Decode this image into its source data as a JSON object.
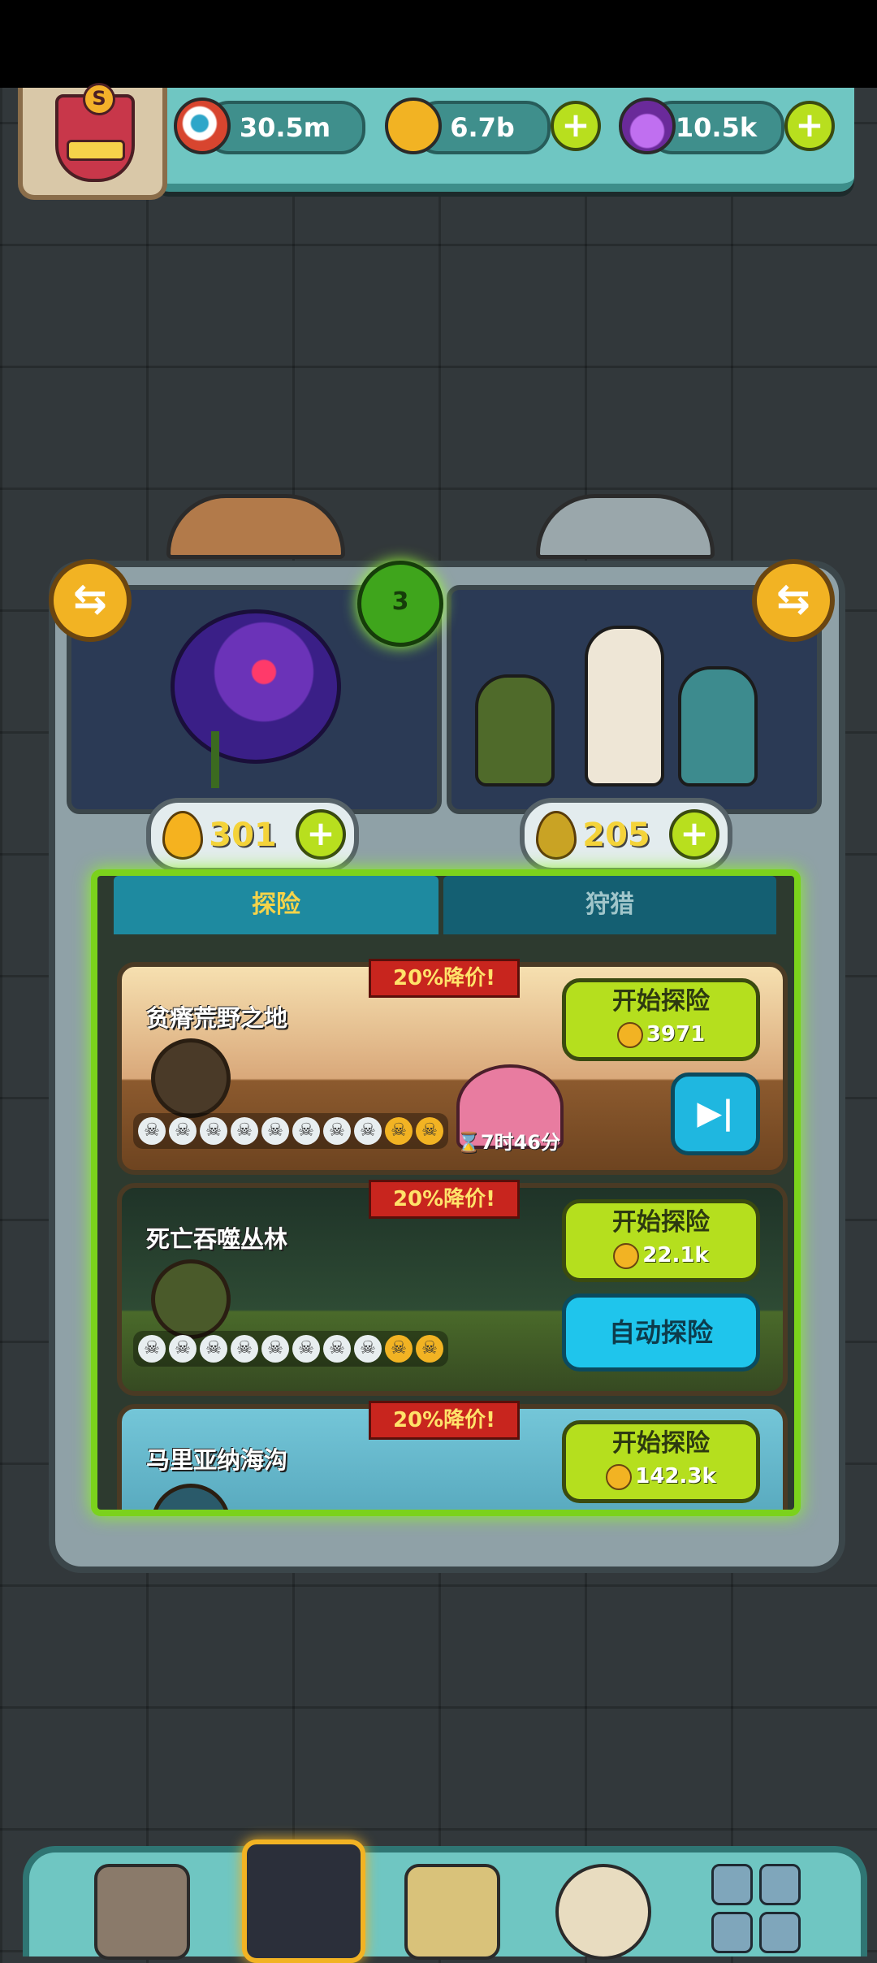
{
  "resources": [
    {
      "name": "eyeball",
      "value": "30.5m",
      "icon": "eyeball-icon",
      "color": "#d8452f",
      "has_plus": false
    },
    {
      "name": "coin",
      "value": "6.7b",
      "icon": "coin-icon",
      "color": "#f2b323",
      "has_plus": true
    },
    {
      "name": "potion",
      "value": "10.5k",
      "icon": "potion-icon",
      "color": "#a24fd6",
      "has_plus": true
    }
  ],
  "emblem_letter": "S",
  "clover_count": "3",
  "currency": [
    {
      "value": "301"
    },
    {
      "value": "205"
    }
  ],
  "tabs": [
    {
      "label": "探险",
      "active": true
    },
    {
      "label": "狩猎",
      "active": false
    }
  ],
  "expeditions": [
    {
      "discount": "20%降价!",
      "name": "贫瘠荒野之地",
      "start_label": "开始探险",
      "cost": "3971",
      "timer": "7时46分",
      "skulls": {
        "white": 8,
        "gold": 2
      }
    },
    {
      "discount": "20%降价!",
      "name": "死亡吞噬丛林",
      "start_label": "开始探险",
      "cost": "22.1k",
      "auto_label": "自动探险",
      "skulls": {
        "white": 8,
        "gold": 2
      }
    },
    {
      "discount": "20%降价!",
      "name": "马里亚纳海沟",
      "start_label": "开始探险",
      "cost": "142.3k"
    }
  ],
  "nav": [
    {
      "name": "shop",
      "icon": "shop-icon"
    },
    {
      "name": "explore",
      "icon": "monster-icon",
      "active": true
    },
    {
      "name": "book",
      "icon": "book-icon"
    },
    {
      "name": "bag",
      "icon": "money-bag-icon"
    },
    {
      "name": "menu",
      "icon": "grid-icon"
    }
  ]
}
